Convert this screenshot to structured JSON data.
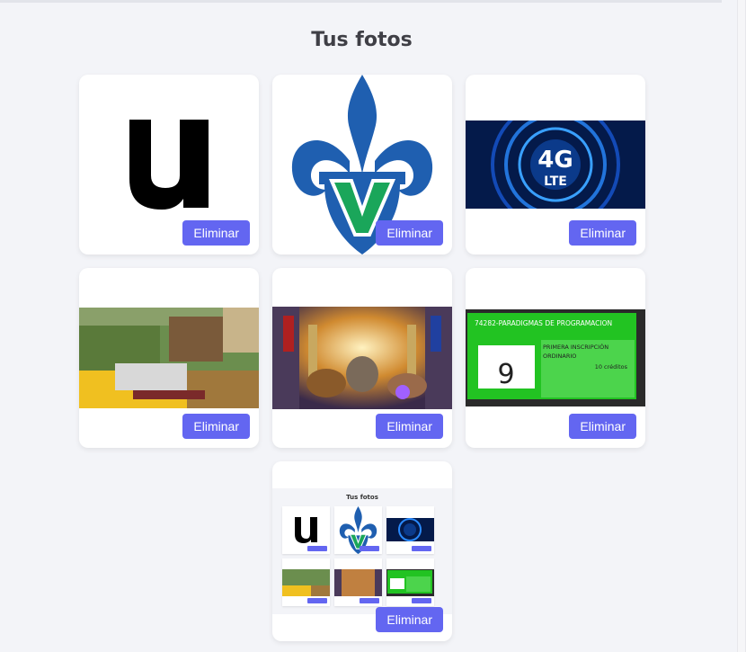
{
  "page": {
    "title": "Tus fotos"
  },
  "photos": [
    {
      "delete_label": "Eliminar"
    },
    {
      "delete_label": "Eliminar"
    },
    {
      "delete_label": "Eliminar",
      "image_text_1": "4G",
      "image_text_2": "LTE"
    },
    {
      "delete_label": "Eliminar"
    },
    {
      "delete_label": "Eliminar"
    },
    {
      "delete_label": "Eliminar",
      "course_title": "74282-PARADIGMAS DE PROGRAMACION",
      "grade": "9",
      "inscription": "PRIMERA INSCRIPCIÓN",
      "type": "ORDINARIO",
      "credits": "10 créditos"
    },
    {
      "delete_label": "Eliminar",
      "inner_title": "Tus fotos"
    }
  ],
  "colors": {
    "accent": "#6366f1",
    "background": "#f3f4f8",
    "uv_blue": "#1f5fb0",
    "uv_green": "#1aa65a",
    "card_green": "#22c322"
  }
}
